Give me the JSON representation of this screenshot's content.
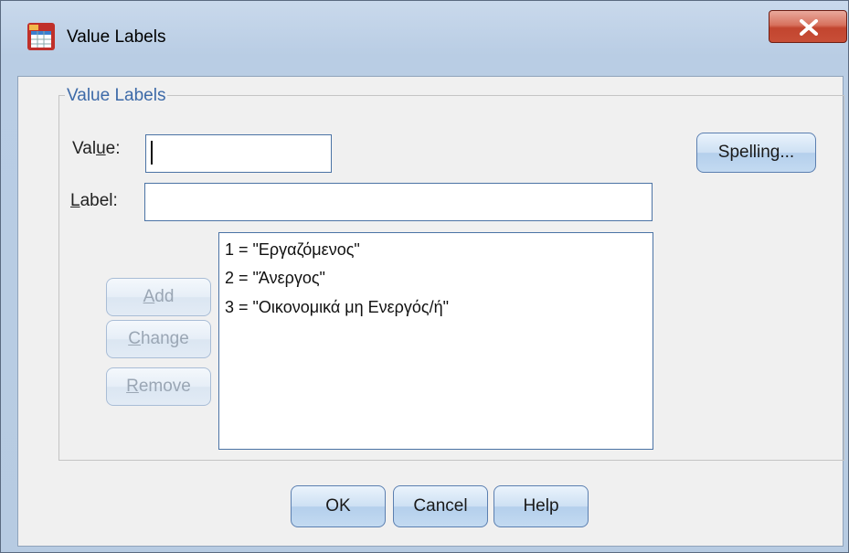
{
  "window": {
    "title": "Value Labels",
    "close_glyph": "X"
  },
  "group": {
    "legend": "Value Labels"
  },
  "value_field": {
    "label_pre": "Val",
    "label_mnemonic": "u",
    "label_post": "e:",
    "value": ""
  },
  "label_field": {
    "label_mnemonic": "L",
    "label_post": "abel:",
    "value": ""
  },
  "buttons": {
    "spelling": "Spelling...",
    "add_mnemonic": "A",
    "add_rest": "dd",
    "change_mnemonic": "C",
    "change_rest": "hange",
    "remove_mnemonic": "R",
    "remove_rest": "emove",
    "ok": "OK",
    "cancel": "Cancel",
    "help": "Help"
  },
  "labels_list": [
    "1 = \"Εργαζόμενος\"",
    "2 = \"Άνεργος\"",
    "3 = \"Οικονομικά μη Ενεργός/ή\""
  ],
  "icons": {
    "app": "spss-table-icon",
    "close": "close-icon"
  }
}
